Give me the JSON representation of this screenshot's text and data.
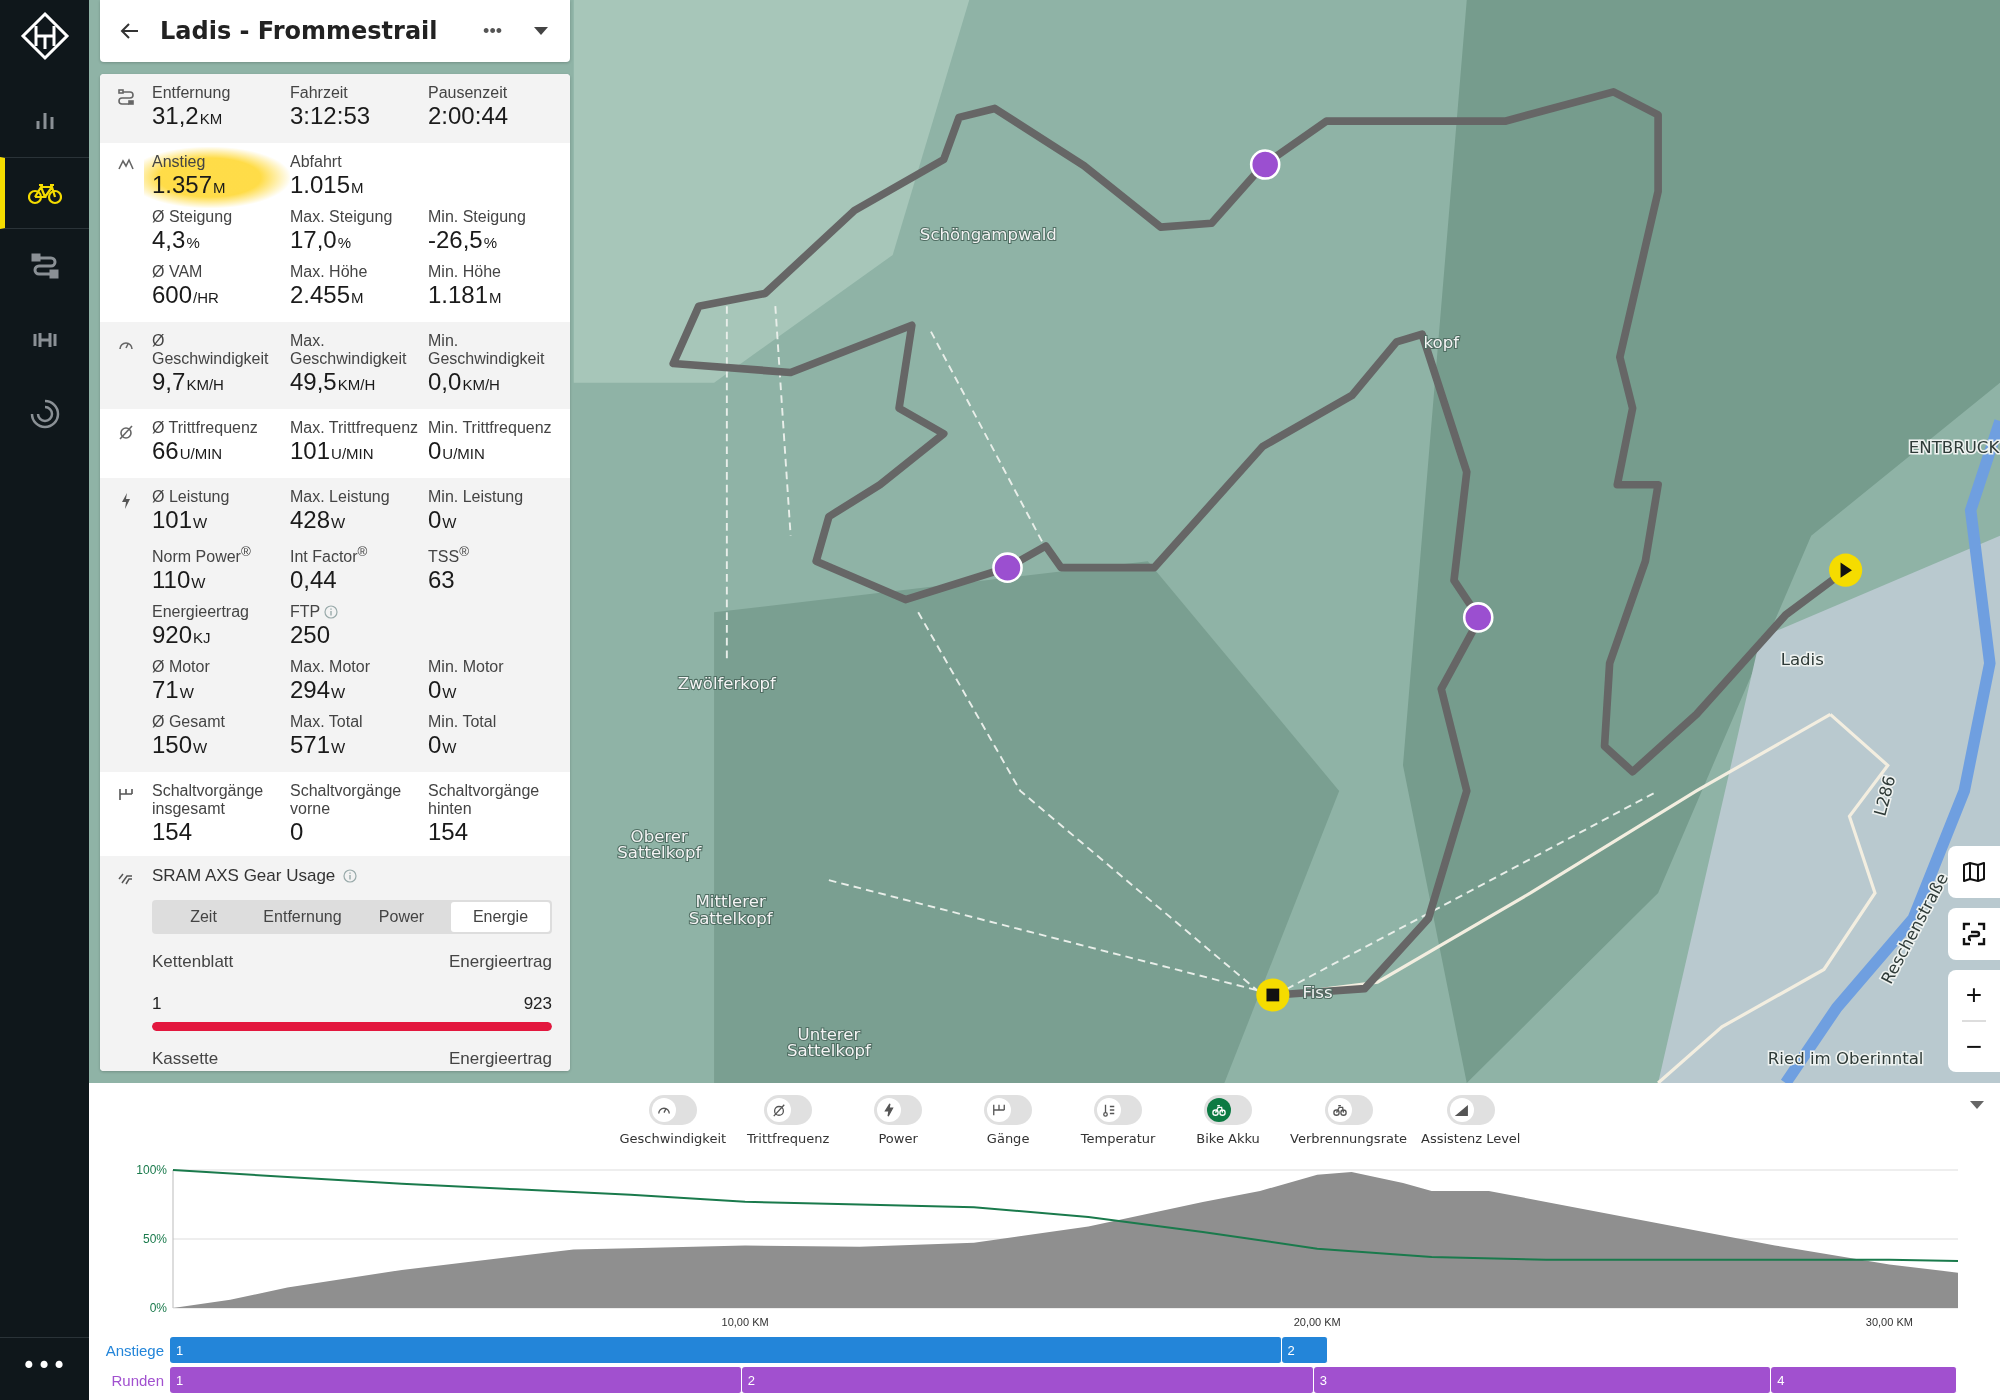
{
  "sidebar": {
    "items": [
      {
        "kind": "stats",
        "selected": false
      },
      {
        "kind": "bike",
        "selected": true
      },
      {
        "kind": "route",
        "selected": false
      },
      {
        "kind": "training",
        "selected": false
      },
      {
        "kind": "progress",
        "selected": false
      }
    ],
    "more": "•••"
  },
  "header": {
    "title": "Ladis - Frommestrail",
    "more": "•••"
  },
  "stat_sections": [
    {
      "kind": "distance",
      "rows": [
        [
          {
            "label": "Entfernung",
            "value": "31,2",
            "unit": "KM"
          },
          {
            "label": "Fahrzeit",
            "value": "3:12:53"
          },
          {
            "label": "Pausenzeit",
            "value": "2:00:44"
          }
        ]
      ]
    },
    {
      "kind": "climb",
      "rows": [
        [
          {
            "label": "Anstieg",
            "value": "1.357",
            "unit": "M",
            "highlighted": true
          },
          {
            "label": "Abfahrt",
            "value": "1.015",
            "unit": "M"
          }
        ],
        [
          {
            "label": "Ø Steigung",
            "value": "4,3",
            "unit": "%"
          },
          {
            "label": "Max. Steigung",
            "value": "17,0",
            "unit": "%"
          },
          {
            "label": "Min. Steigung",
            "value": "-26,5",
            "unit": "%"
          }
        ],
        [
          {
            "label": "Ø VAM",
            "value": "600",
            "unit": "/HR"
          },
          {
            "label": "Max. Höhe",
            "value": "2.455",
            "unit": "M"
          },
          {
            "label": "Min. Höhe",
            "value": "1.181",
            "unit": "M"
          }
        ]
      ]
    },
    {
      "kind": "speed",
      "rows": [
        [
          {
            "label": "Ø Geschwindigkeit",
            "value": "9,7",
            "unit": "KM/H"
          },
          {
            "label": "Max. Geschwindigkeit",
            "value": "49,5",
            "unit": "KM/H"
          },
          {
            "label": "Min. Geschwindigkeit",
            "value": "0,0",
            "unit": "KM/H"
          }
        ]
      ]
    },
    {
      "kind": "cadence",
      "rows": [
        [
          {
            "label": "Ø Trittfrequenz",
            "value": "66",
            "unit": "U/MIN"
          },
          {
            "label": "Max. Trittfrequenz",
            "value": "101",
            "unit": "U/MIN"
          },
          {
            "label": "Min. Trittfrequenz",
            "value": "0",
            "unit": "U/MIN"
          }
        ]
      ]
    },
    {
      "kind": "power",
      "rows": [
        [
          {
            "label": "Ø Leistung",
            "value": "101",
            "unit": "W"
          },
          {
            "label": "Max. Leistung",
            "value": "428",
            "unit": "W"
          },
          {
            "label": "Min. Leistung",
            "value": "0",
            "unit": "W"
          }
        ],
        [
          {
            "label": "Norm Power$^{®}$",
            "value": "110",
            "unit": "W"
          },
          {
            "label": "Int Factor$^{®}$",
            "value": "0,44"
          },
          {
            "label": "TSS$^{®}$",
            "value": "63"
          }
        ],
        [
          {
            "label": "Energieertrag",
            "value": "920",
            "unit": "KJ"
          },
          {
            "label": "FTP",
            "value": "250",
            "info": true
          }
        ],
        [
          {
            "label": "Ø Motor",
            "value": "71",
            "unit": "W"
          },
          {
            "label": "Max. Motor",
            "value": "294",
            "unit": "W"
          },
          {
            "label": "Min. Motor",
            "value": "0",
            "unit": "W"
          }
        ],
        [
          {
            "label": "Ø Gesamt",
            "value": "150",
            "unit": "W"
          },
          {
            "label": "Max. Total",
            "value": "571",
            "unit": "W"
          },
          {
            "label": "Min. Total",
            "value": "0",
            "unit": "W"
          }
        ]
      ]
    },
    {
      "kind": "shifts",
      "rows": [
        [
          {
            "label": "Schaltvorgänge insgesamt",
            "value": "154"
          },
          {
            "label": "Schaltvorgänge vorne",
            "value": "0"
          },
          {
            "label": "Schaltvorgänge hinten",
            "value": "154"
          }
        ]
      ]
    }
  ],
  "gear_usage": {
    "title": "SRAM AXS Gear Usage",
    "tabs": [
      {
        "label": "Zeit",
        "selected": false
      },
      {
        "label": "Entfernung",
        "selected": false
      },
      {
        "label": "Power",
        "selected": false
      },
      {
        "label": "Energie",
        "selected": true
      }
    ],
    "chainring": {
      "heading": "Kettenblatt",
      "column": "Energieertrag",
      "rows": [
        {
          "gear": "1",
          "value": "923",
          "level": 1.0
        }
      ]
    },
    "cassette": {
      "heading": "Kassette",
      "column": "Energieertrag"
    }
  },
  "map": {
    "labels": [
      {
        "lines": [
          "Schöngampwald"
        ]
      },
      {
        "lines": [
          "kopf"
        ]
      },
      {
        "lines": [
          "ENTBRUCK"
        ]
      },
      {
        "lines": [
          "Ladis"
        ]
      },
      {
        "lines": [
          "Zwölferkopf"
        ]
      },
      {
        "lines": [
          "Oberer",
          "Sattelkopf"
        ]
      },
      {
        "lines": [
          "Mittlerer",
          "Sattelkopf"
        ]
      },
      {
        "lines": [
          "Unterer",
          "Sattelkopf"
        ]
      },
      {
        "lines": [
          "Fiss"
        ]
      },
      {
        "lines": [
          "Ried im Oberinntal"
        ]
      },
      {
        "lines": [
          "L286"
        ]
      },
      {
        "lines": [
          "Reschenstraße"
        ]
      }
    ],
    "zoom_in": "+",
    "zoom_out": "−"
  },
  "chart_toggles": [
    {
      "label": "Geschwindigkeit",
      "kind": "speed",
      "on": false
    },
    {
      "label": "Trittfrequenz",
      "kind": "cadence",
      "on": false
    },
    {
      "label": "Power",
      "kind": "power",
      "on": false
    },
    {
      "label": "Gänge",
      "kind": "gears",
      "on": false
    },
    {
      "label": "Temperatur",
      "kind": "temperature",
      "on": false
    },
    {
      "label": "Bike Akku",
      "kind": "battery",
      "on": true
    },
    {
      "label": "Verbrennungsrate",
      "kind": "burn",
      "on": false
    },
    {
      "label": "Assistenz Level",
      "kind": "assist",
      "on": false
    }
  ],
  "chart": {
    "chart_data": {
      "type": "line",
      "x": [
        0,
        2,
        4,
        6,
        8,
        10,
        12,
        14,
        16,
        18,
        20,
        22,
        24,
        26,
        28,
        30,
        31.2
      ],
      "ylim": [
        0,
        100
      ],
      "xlim": [
        0,
        31.2
      ],
      "yticks": [
        {
          "value": 0,
          "label": "0%"
        },
        {
          "value": 50,
          "label": "50%"
        },
        {
          "value": 100,
          "label": "100%"
        }
      ],
      "xticks": [
        {
          "value": 10,
          "label": "10,00 KM"
        },
        {
          "value": 20,
          "label": "20,00 KM"
        },
        {
          "value": 30,
          "label": "30,00 KM"
        }
      ],
      "series": [
        {
          "color": "#1a7a4c",
          "values": [
            100,
            95,
            90,
            86,
            82,
            77,
            75,
            73,
            66,
            55,
            43,
            37,
            35,
            35,
            35,
            35,
            34
          ]
        }
      ]
    }
  },
  "segments": [
    {
      "label": "Anstiege",
      "color": "#2385d9",
      "items": [
        "1",
        "2"
      ]
    },
    {
      "label": "Runden",
      "color": "#a150cf",
      "items": [
        "1",
        "2",
        "3",
        "4"
      ]
    }
  ]
}
